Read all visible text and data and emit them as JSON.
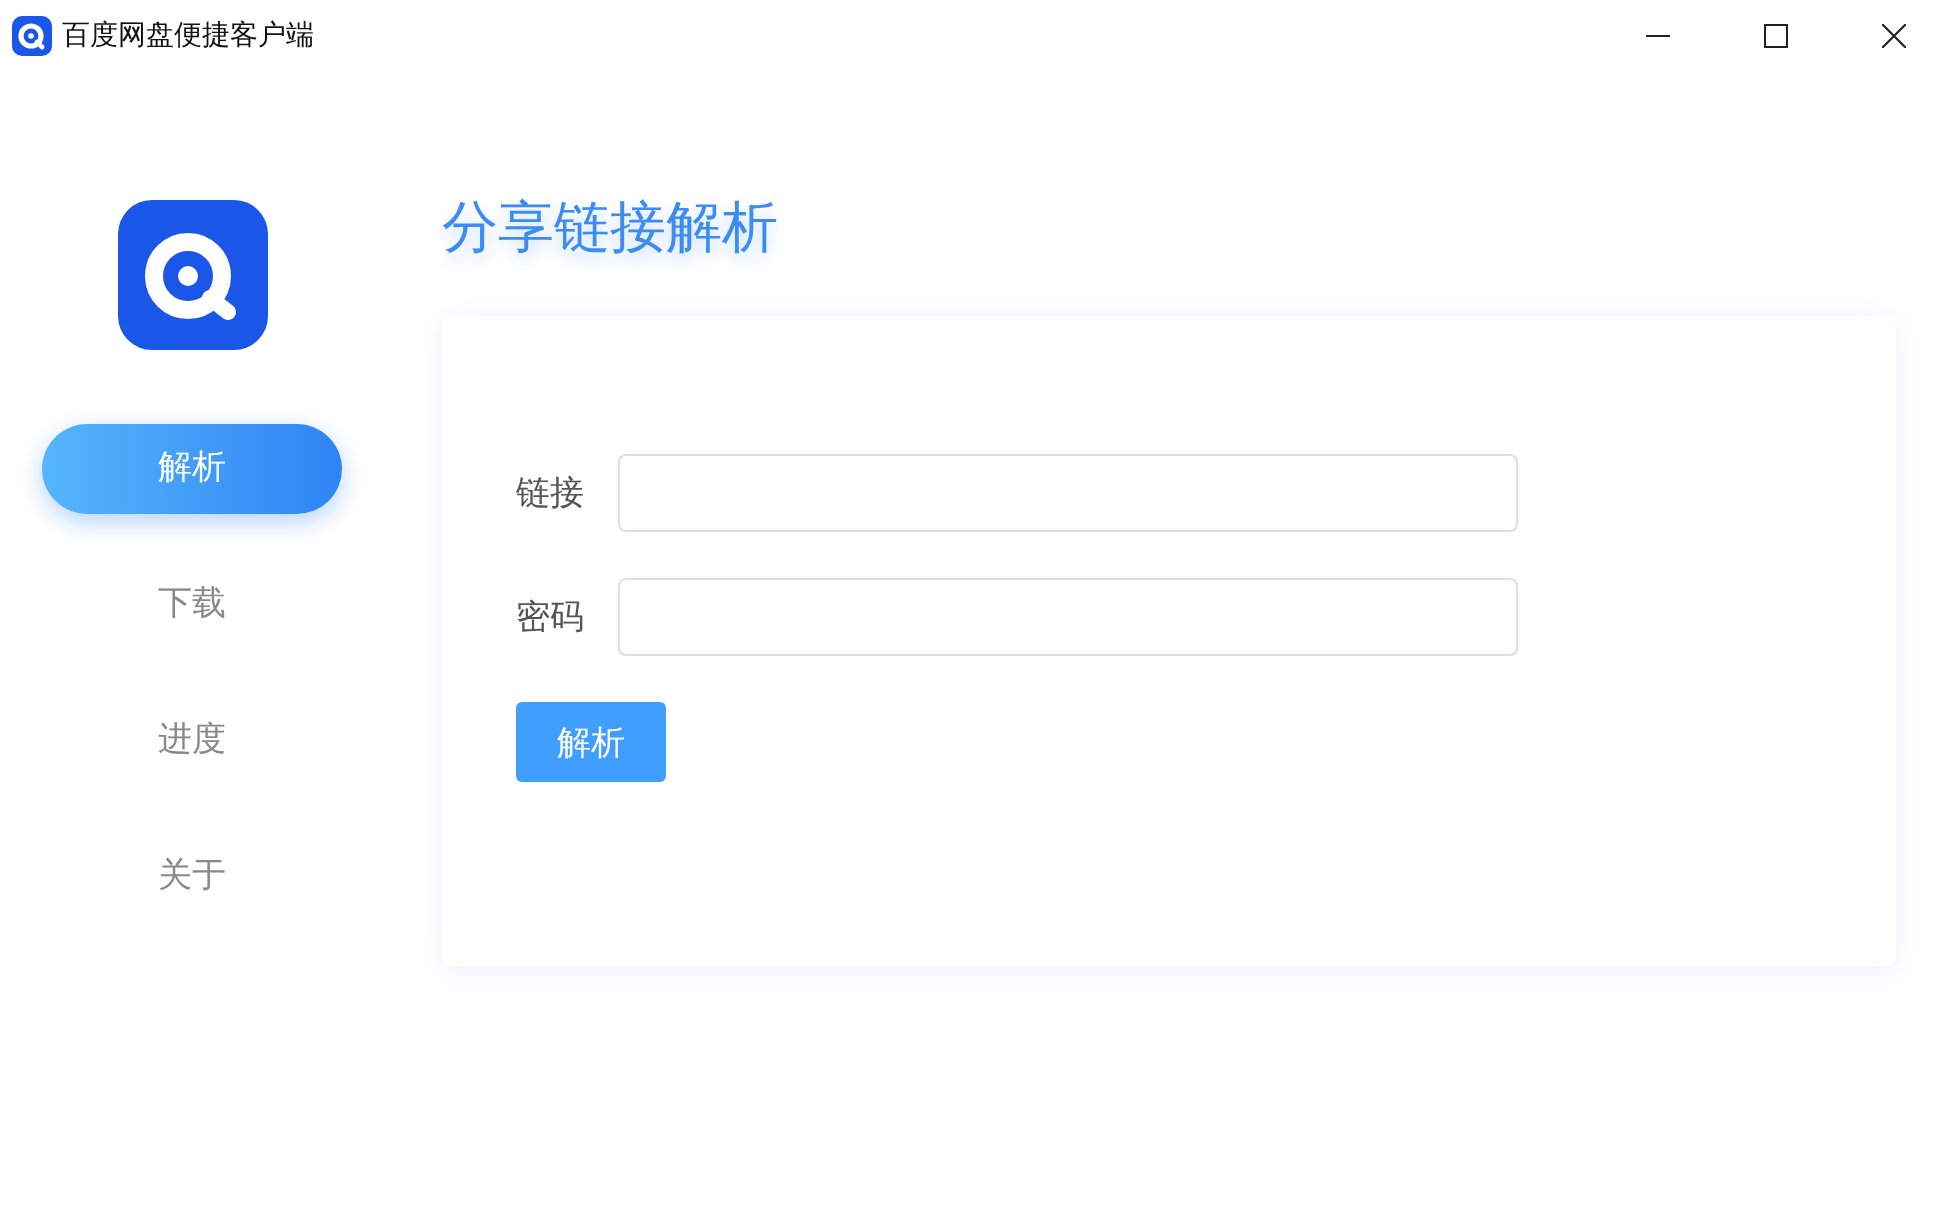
{
  "window": {
    "title": "百度网盘便捷客户端"
  },
  "sidebar": {
    "items": [
      {
        "label": "解析",
        "selected": true
      },
      {
        "label": "下载",
        "selected": false
      },
      {
        "label": "进度",
        "selected": false
      },
      {
        "label": "关于",
        "selected": false
      }
    ]
  },
  "main": {
    "heading": "分享链接解析",
    "fields": [
      {
        "label": "链接"
      },
      {
        "label": "密码"
      }
    ],
    "button": "解析"
  }
}
